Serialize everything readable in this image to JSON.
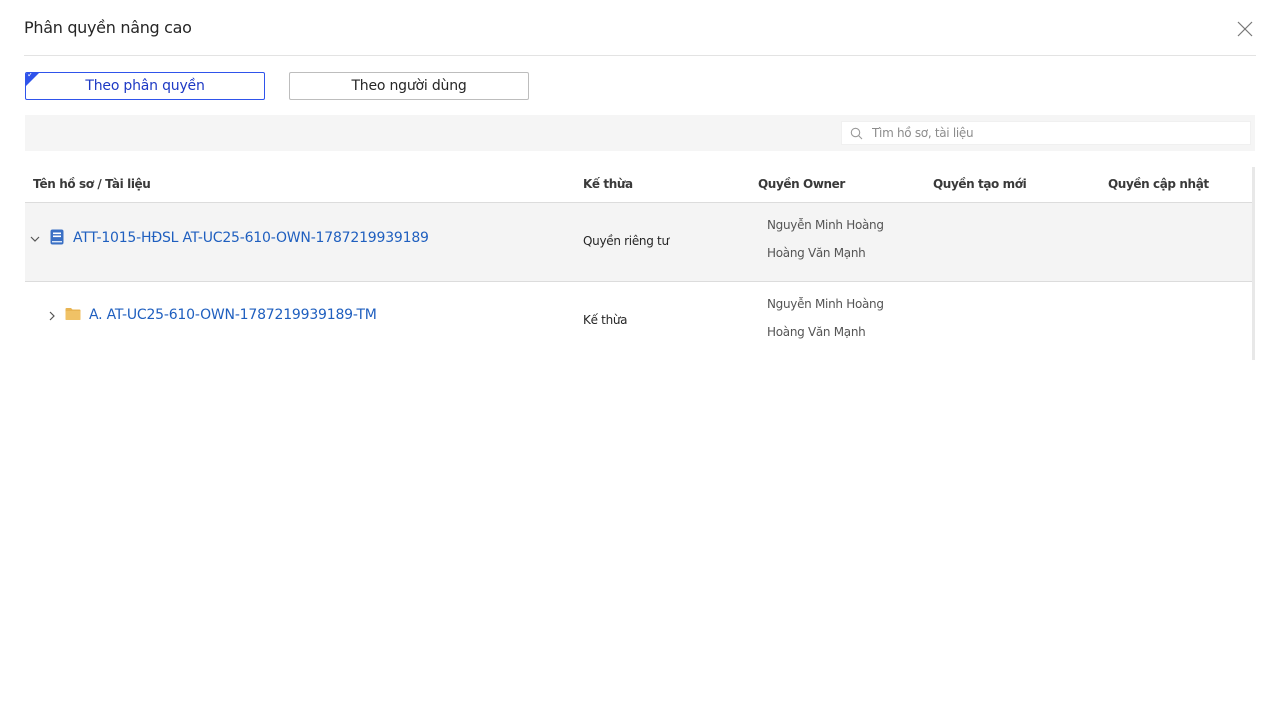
{
  "modal": {
    "title": "Phân quyền nâng cao"
  },
  "tabs": [
    {
      "label": "Theo phân quyền",
      "active": true
    },
    {
      "label": "Theo người dùng",
      "active": false
    }
  ],
  "search": {
    "placeholder": "Tìm hồ sơ, tài liệu",
    "value": ""
  },
  "table": {
    "columns": [
      "Tên hồ sơ / Tài liệu",
      "Kế thừa",
      "Quyền Owner",
      "Quyền tạo mới",
      "Quyền cập nhật"
    ],
    "rows": [
      {
        "name": "ATT-1015-HĐSL AT-UC25-610-OWN-1787219939189",
        "icon": "document-icon",
        "expanded": true,
        "inherit": "Quyền riêng tư",
        "owners": [
          "Nguyễn Minh Hoàng",
          "Hoàng Văn Mạnh"
        ],
        "create": "",
        "update": ""
      },
      {
        "name": "A. AT-UC25-610-OWN-1787219939189-TM",
        "icon": "folder-icon",
        "expanded": false,
        "inherit": "Kế thừa",
        "owners": [
          "Nguyễn Minh Hoàng",
          "Hoàng Văn Mạnh"
        ],
        "create": "",
        "update": ""
      }
    ]
  },
  "colors": {
    "accent": "#2f54eb",
    "link": "#1f5fbf",
    "folder": "#e8b452",
    "document": "#3a6fc4"
  }
}
